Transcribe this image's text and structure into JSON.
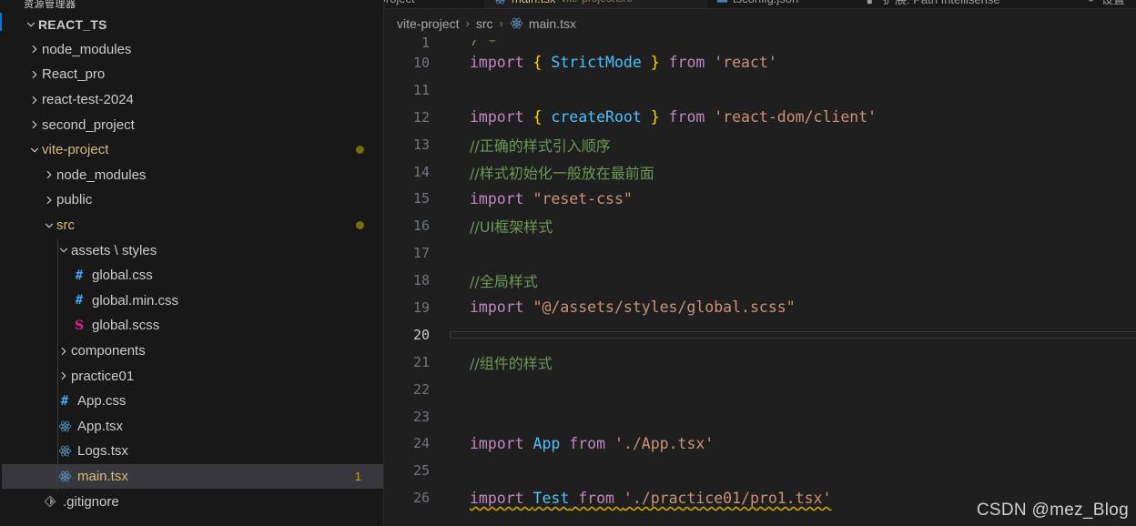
{
  "window": {
    "explorer_header": "资源管理器",
    "watermark": "CSDN @mez_Blog"
  },
  "sidebar": {
    "root_label": "REACT_TS",
    "items": [
      {
        "label": "node_modules",
        "kind": "folder",
        "indent": 1,
        "expanded": false,
        "icon": "chevron-right-icon",
        "color": "white"
      },
      {
        "label": "React_pro",
        "kind": "folder",
        "indent": 1,
        "expanded": false,
        "icon": "chevron-right-icon",
        "color": "white"
      },
      {
        "label": "react-test-2024",
        "kind": "folder",
        "indent": 1,
        "expanded": false,
        "icon": "chevron-right-icon",
        "color": "white"
      },
      {
        "label": "second_project",
        "kind": "folder",
        "indent": 1,
        "expanded": false,
        "icon": "chevron-right-icon",
        "color": "white"
      },
      {
        "label": "vite-project",
        "kind": "folder",
        "indent": 1,
        "expanded": true,
        "icon": "chevron-down-icon",
        "color": "modified",
        "dot": true
      },
      {
        "label": "node_modules",
        "kind": "folder",
        "indent": 2,
        "expanded": false,
        "icon": "chevron-right-icon",
        "color": "white"
      },
      {
        "label": "public",
        "kind": "folder",
        "indent": 2,
        "expanded": false,
        "icon": "chevron-right-icon",
        "color": "white"
      },
      {
        "label": "src",
        "kind": "folder",
        "indent": 2,
        "expanded": true,
        "icon": "chevron-down-icon",
        "color": "modified",
        "dot": true
      },
      {
        "label": "assets \\ styles",
        "kind": "folder",
        "indent": 3,
        "expanded": true,
        "icon": "chevron-down-icon",
        "color": "white"
      },
      {
        "label": "global.css",
        "kind": "file",
        "indent": 4,
        "icon": "css-hash-icon",
        "color": "white"
      },
      {
        "label": "global.min.css",
        "kind": "file",
        "indent": 4,
        "icon": "css-hash-icon",
        "color": "white"
      },
      {
        "label": "global.scss",
        "kind": "file",
        "indent": 4,
        "icon": "sass-icon",
        "color": "white"
      },
      {
        "label": "components",
        "kind": "folder",
        "indent": 3,
        "expanded": false,
        "icon": "chevron-right-icon",
        "color": "white"
      },
      {
        "label": "practice01",
        "kind": "folder",
        "indent": 3,
        "expanded": false,
        "icon": "chevron-right-icon",
        "color": "white"
      },
      {
        "label": "App.css",
        "kind": "file",
        "indent": 3,
        "icon": "css-hash-icon",
        "color": "white"
      },
      {
        "label": "App.tsx",
        "kind": "file",
        "indent": 3,
        "icon": "react-icon",
        "color": "white"
      },
      {
        "label": "Logs.tsx",
        "kind": "file",
        "indent": 3,
        "icon": "react-icon",
        "color": "white"
      },
      {
        "label": "main.tsx",
        "kind": "file",
        "indent": 3,
        "icon": "react-icon",
        "color": "selected",
        "selected": true,
        "badge": "1"
      },
      {
        "label": ".gitignore",
        "kind": "file",
        "indent": 2,
        "icon": "git-icon",
        "color": "white"
      }
    ]
  },
  "tabs": [
    {
      "label": "vite-project",
      "active": false,
      "icon": "none"
    },
    {
      "label": "main.tsx",
      "suffix": "vite-project\\src",
      "active": true,
      "icon": "react-icon"
    },
    {
      "label": "tsconfig.json",
      "active": false,
      "icon": "json-icon"
    },
    {
      "label": "扩展: Path Intellisense",
      "active": false,
      "icon": "extension-icon"
    },
    {
      "label": "设置",
      "active": false,
      "icon": "gear-icon"
    }
  ],
  "breadcrumb": {
    "segments": [
      "vite-project",
      "src",
      "main.tsx"
    ],
    "separator": "›",
    "file_icon": "react-icon"
  },
  "editor": {
    "file": "main.tsx",
    "first_visible_line": 1,
    "cursor_line": 20,
    "lines": [
      {
        "n": "1",
        "partial": true,
        "tokens": [
          {
            "t": "/ *",
            "c": "cm"
          }
        ]
      },
      {
        "n": "10",
        "tokens": [
          {
            "t": "import ",
            "c": "k"
          },
          {
            "t": "{ ",
            "c": "br"
          },
          {
            "t": "StrictMode",
            "c": "id"
          },
          {
            "t": " }",
            "c": "br"
          },
          {
            "t": " from ",
            "c": "k"
          },
          {
            "t": "'react'",
            "c": "s"
          }
        ]
      },
      {
        "n": "11",
        "tokens": []
      },
      {
        "n": "12",
        "tokens": [
          {
            "t": "import ",
            "c": "k"
          },
          {
            "t": "{ ",
            "c": "br"
          },
          {
            "t": "createRoot",
            "c": "id"
          },
          {
            "t": " }",
            "c": "br"
          },
          {
            "t": " from ",
            "c": "k"
          },
          {
            "t": "'react-dom/client'",
            "c": "s"
          }
        ]
      },
      {
        "n": "13",
        "tokens": [
          {
            "t": "//正确的样式引入顺序",
            "c": "cm"
          }
        ]
      },
      {
        "n": "14",
        "tokens": [
          {
            "t": "//样式初始化一般放在最前面",
            "c": "cm"
          }
        ]
      },
      {
        "n": "15",
        "tokens": [
          {
            "t": "import ",
            "c": "k"
          },
          {
            "t": "\"reset-css\"",
            "c": "s"
          }
        ]
      },
      {
        "n": "16",
        "tokens": [
          {
            "t": "//UI框架样式",
            "c": "cm"
          }
        ]
      },
      {
        "n": "17",
        "tokens": []
      },
      {
        "n": "18",
        "tokens": [
          {
            "t": "//全局样式",
            "c": "cm"
          }
        ]
      },
      {
        "n": "19",
        "tokens": [
          {
            "t": "import ",
            "c": "k"
          },
          {
            "t": "\"@/assets/styles/global.scss\"",
            "c": "s"
          }
        ]
      },
      {
        "n": "20",
        "tokens": [],
        "current": true
      },
      {
        "n": "21",
        "tokens": [
          {
            "t": "//组件的样式",
            "c": "cm"
          }
        ]
      },
      {
        "n": "22",
        "tokens": []
      },
      {
        "n": "23",
        "tokens": []
      },
      {
        "n": "24",
        "tokens": [
          {
            "t": "import ",
            "c": "k"
          },
          {
            "t": "App",
            "c": "id"
          },
          {
            "t": " from ",
            "c": "k"
          },
          {
            "t": "'./App.tsx'",
            "c": "s"
          }
        ]
      },
      {
        "n": "25",
        "tokens": []
      },
      {
        "n": "26",
        "squiggly": true,
        "tokens": [
          {
            "t": "import ",
            "c": "k"
          },
          {
            "t": "Test",
            "c": "id"
          },
          {
            "t": " from ",
            "c": "k"
          },
          {
            "t": "'./practice01/pro1.tsx'",
            "c": "s"
          }
        ]
      }
    ]
  },
  "colors": {
    "bg_editor": "#1f1f1f",
    "bg_sidebar": "#181818",
    "selection": "#37373d",
    "accent": "#0078d4",
    "keyword": "#c586c0",
    "identifier": "#4fc1ff",
    "brace": "#ffd700",
    "string": "#ce9178",
    "comment": "#6a9955",
    "modified": "#d7ba7d",
    "warning": "#cca700"
  }
}
